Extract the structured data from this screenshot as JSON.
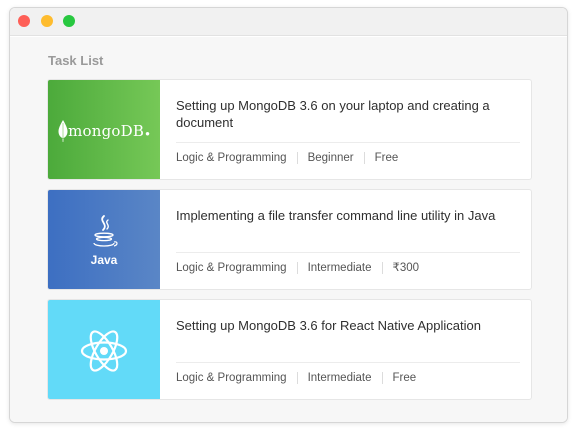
{
  "window": {
    "buttons": {
      "close_color": "#fe5f57",
      "minimize_color": "#febc2e",
      "zoom_color": "#28c840"
    }
  },
  "task_list": {
    "title": "Task List",
    "tasks": [
      {
        "title": "Setting up MongoDB 3.6 on your laptop and creating a document",
        "thumbnail": {
          "icon": "mongodb-logo",
          "text": "mongoDB"
        },
        "category": "Logic & Programming",
        "level": "Beginner",
        "price": "Free"
      },
      {
        "title": "Implementing a file transfer command line utility in Java",
        "thumbnail": {
          "icon": "java-logo",
          "text": "Java"
        },
        "category": "Logic & Programming",
        "level": "Intermediate",
        "price": "₹300"
      },
      {
        "title": "Setting up MongoDB 3.6 for React Native Application",
        "thumbnail": {
          "icon": "react-logo"
        },
        "category": "Logic & Programming",
        "level": "Intermediate",
        "price": "Free"
      }
    ]
  }
}
